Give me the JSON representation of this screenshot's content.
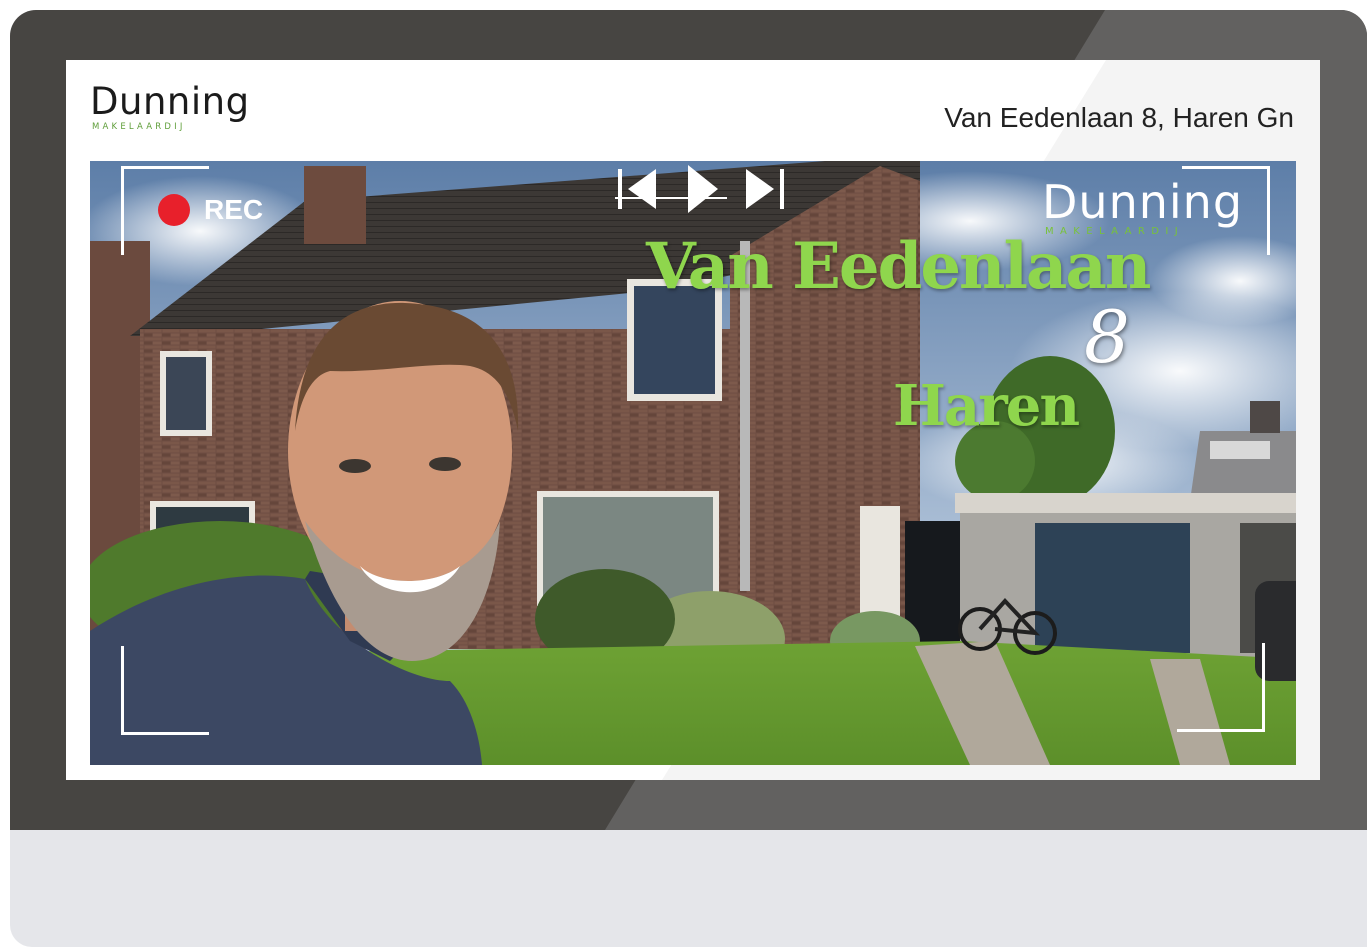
{
  "header": {
    "logo_text": "Dunning",
    "logo_subtext": "MAKELAARDIJ",
    "address": "Van Eedenlaan 8, Haren Gn"
  },
  "video": {
    "rec_label": "REC",
    "overlay_logo_text": "Dunning",
    "overlay_logo_subtext": "MAKELAARDIJ",
    "title_street": "Van Eedenlaan",
    "title_number": "8",
    "title_city": "Haren",
    "controls": [
      "previous-icon",
      "play-icon",
      "next-icon"
    ]
  },
  "colors": {
    "bezel": "#474542",
    "accent_green": "#8fd64d",
    "rec_red": "#e8202b",
    "logo_green": "#5f9e3a"
  }
}
